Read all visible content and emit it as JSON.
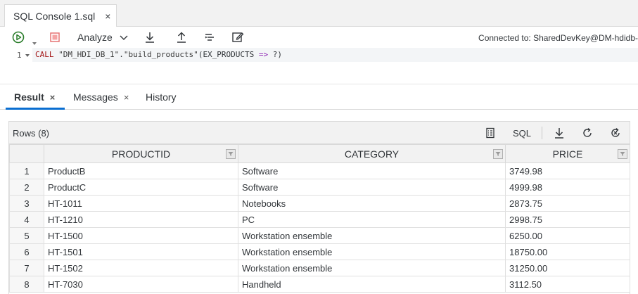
{
  "editor_tab": {
    "title": "SQL Console 1.sql",
    "close": "×"
  },
  "toolbar": {
    "analyze_label": "Analyze",
    "connection_status": "Connected to: SharedDevKey@DM-hdidb-"
  },
  "editor": {
    "line_number": "1",
    "code": {
      "keyword": "CALL",
      "schema": "\"DM_HDI_DB_1\"",
      "dot": ".",
      "procedure": "\"build_products\"",
      "open": "(",
      "param": "EX_PRODUCTS",
      "arrow": " => ",
      "placeholder": "?",
      "close": ")"
    }
  },
  "result_tabs": [
    {
      "label": "Result",
      "close": "×"
    },
    {
      "label": "Messages",
      "close": "×"
    },
    {
      "label": "History"
    }
  ],
  "result": {
    "rows_label": "Rows (8)",
    "sql_label": "SQL",
    "columns": [
      "PRODUCTID",
      "CATEGORY",
      "PRICE"
    ],
    "rows": [
      {
        "idx": "1",
        "PRODUCTID": "ProductB",
        "CATEGORY": "Software",
        "PRICE": "3749.98"
      },
      {
        "idx": "2",
        "PRODUCTID": "ProductC",
        "CATEGORY": "Software",
        "PRICE": "4999.98"
      },
      {
        "idx": "3",
        "PRODUCTID": "HT-1011",
        "CATEGORY": "Notebooks",
        "PRICE": "2873.75"
      },
      {
        "idx": "4",
        "PRODUCTID": "HT-1210",
        "CATEGORY": "PC",
        "PRICE": "2998.75"
      },
      {
        "idx": "5",
        "PRODUCTID": "HT-1500",
        "CATEGORY": "Workstation ensemble",
        "PRICE": "6250.00"
      },
      {
        "idx": "6",
        "PRODUCTID": "HT-1501",
        "CATEGORY": "Workstation ensemble",
        "PRICE": "18750.00"
      },
      {
        "idx": "7",
        "PRODUCTID": "HT-1502",
        "CATEGORY": "Workstation ensemble",
        "PRICE": "31250.00"
      },
      {
        "idx": "8",
        "PRODUCTID": "HT-7030",
        "CATEGORY": "Handheld",
        "PRICE": "3112.50"
      }
    ]
  },
  "colors": {
    "run_green": "#2b7d2b",
    "stop_red": "#e57373",
    "accent_blue": "#0a6ed1",
    "icon_gray": "#32363a"
  },
  "icons": [
    "run-icon",
    "stop-icon",
    "chevron-down-icon",
    "download-icon",
    "upload-icon",
    "format-icon",
    "edit-icon",
    "column-settings-icon",
    "download-icon",
    "refresh-icon",
    "clear-icon",
    "filter-icon"
  ]
}
